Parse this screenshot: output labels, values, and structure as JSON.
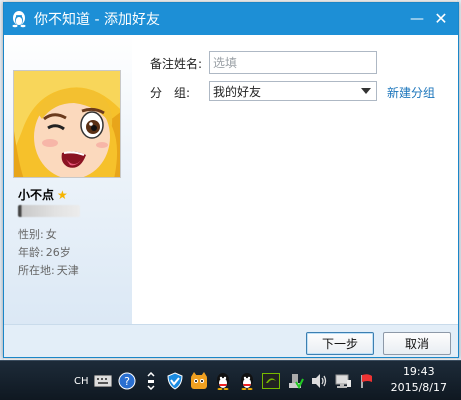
{
  "window": {
    "title": "你不知道 - 添加好友",
    "minimize_glyph": "—",
    "close_glyph": "✕"
  },
  "profile": {
    "nickname": "小不点",
    "gender_label": "性别:",
    "gender_value": "女",
    "age_label": "年龄:",
    "age_value": "26岁",
    "location_label": "所在地:",
    "location_value": "天津"
  },
  "form": {
    "remark_label": "备注姓名:",
    "remark_placeholder": "选填",
    "group_label": "分　组:",
    "group_value": "我的好友",
    "new_group_link": "新建分组"
  },
  "buttons": {
    "next": "下一步",
    "cancel": "取消"
  },
  "taskbar": {
    "input_method": "CH",
    "time": "19:43",
    "date": "2015/8/17"
  },
  "colors": {
    "titlebar": "#1d8fd6",
    "link": "#1b75bb",
    "star": "#f5b400"
  }
}
